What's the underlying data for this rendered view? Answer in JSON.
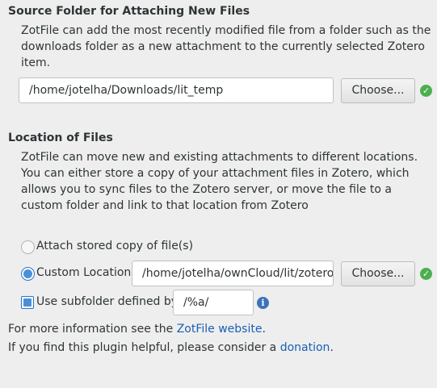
{
  "source_section": {
    "title": "Source Folder for Attaching New Files",
    "description": "ZotFile can add the most recently modified file from a folder such as the downloads folder as a new attachment to the currently selected Zotero item.",
    "folder_path": "/home/jotelha/Downloads/lit_temp",
    "choose_label": "Choose..."
  },
  "location_section": {
    "title": "Location of Files",
    "description": "ZotFile can move new and existing attachments to different locations. You can either store a copy of your attachment files in Zotero, which allows you to sync files to the Zotero server, or move the file to a custom folder and link to that location from Zotero",
    "option_stored_label": "Attach stored copy of file(s)",
    "option_custom_label": "Custom Location:",
    "custom_path": "/home/jotelha/ownCloud/lit/zotero",
    "choose_label": "Choose...",
    "subfolder_label": "Use subfolder defined by",
    "subfolder_pattern": "/%a/"
  },
  "footer": {
    "info_prefix": "For more information see the ",
    "info_link": "ZotFile website",
    "info_suffix": ".",
    "donation_prefix": "If you find this plugin helpful, please consider a ",
    "donation_link": "donation",
    "donation_suffix": "."
  },
  "icons": {
    "valid": "checkmark-circle-icon",
    "info": "info-icon"
  },
  "colors": {
    "link": "#1a5fb4",
    "accent": "#4a90d9",
    "valid_green": "#4caf50"
  }
}
